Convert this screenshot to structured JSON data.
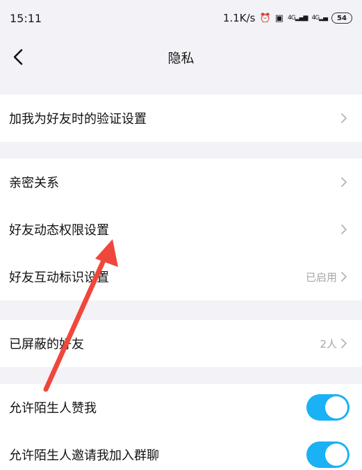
{
  "status_bar": {
    "time": "15:11",
    "network_speed": "1.1K/s",
    "signal_label_1": "4G",
    "signal_label_2": "4G",
    "battery": "54"
  },
  "nav": {
    "title": "隐私"
  },
  "groups": [
    {
      "items": [
        {
          "label": "加我为好友时的验证设置",
          "value": ""
        }
      ]
    },
    {
      "items": [
        {
          "label": "亲密关系",
          "value": ""
        },
        {
          "label": "好友动态权限设置",
          "value": ""
        },
        {
          "label": "好友互动标识设置",
          "value": "已启用"
        }
      ]
    },
    {
      "items": [
        {
          "label": "已屏蔽的好友",
          "value": "2人"
        }
      ]
    },
    {
      "items": [
        {
          "label": "允许陌生人赞我",
          "toggle": true
        },
        {
          "label": "允许陌生人邀请我加入群聊",
          "toggle": true
        }
      ]
    }
  ],
  "colors": {
    "accent_toggle": "#1ab1f5",
    "annotation_arrow": "#f0473c",
    "background": "#f2f2f7"
  }
}
